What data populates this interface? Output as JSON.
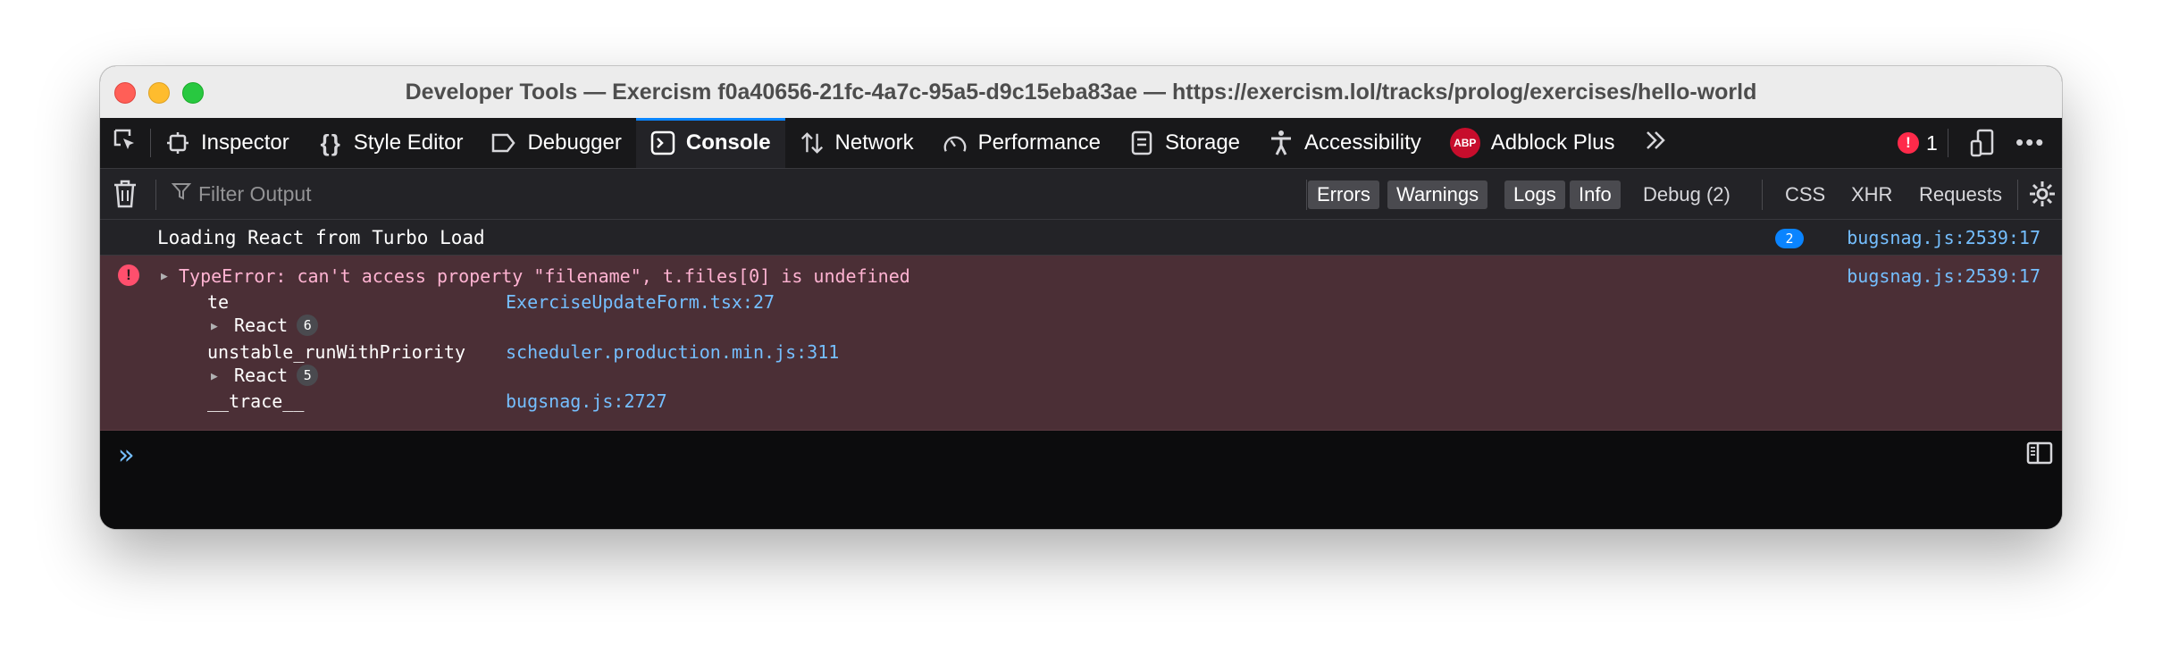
{
  "window": {
    "title": "Developer Tools — Exercism f0a40656-21fc-4a7c-95a5-d9c15eba83ae — https://exercism.lol/tracks/prolog/exercises/hello-world"
  },
  "toolbar": {
    "tabs": [
      {
        "label": "Inspector",
        "icon": "inspector-icon"
      },
      {
        "label": "Style Editor",
        "icon": "braces-icon"
      },
      {
        "label": "Debugger",
        "icon": "debugger-icon"
      },
      {
        "label": "Console",
        "icon": "console-icon",
        "active": true
      },
      {
        "label": "Network",
        "icon": "network-arrows-icon"
      },
      {
        "label": "Performance",
        "icon": "gauge-icon"
      },
      {
        "label": "Storage",
        "icon": "storage-icon"
      },
      {
        "label": "Accessibility",
        "icon": "accessibility-icon"
      },
      {
        "label": "Adblock Plus",
        "icon": "abp-icon"
      }
    ],
    "abp_icon_text": "ABP",
    "error_count": "1"
  },
  "filterbar": {
    "placeholder": "Filter Output",
    "levels": [
      "Errors",
      "Warnings",
      "Logs",
      "Info",
      "Debug (2)"
    ],
    "types": [
      "CSS",
      "XHR",
      "Requests"
    ]
  },
  "console": {
    "log": {
      "text": "Loading React from Turbo Load",
      "count": "2",
      "location": "bugsnag.js:2539:17"
    },
    "error": {
      "message": "TypeError: can't access property \"filename\", t.files[0] is undefined",
      "location": "bugsnag.js:2539:17",
      "stack": [
        {
          "fn": "te",
          "src": "ExerciseUpdateForm.tsx:27"
        },
        {
          "group": "React",
          "count": "6"
        },
        {
          "fn": "unstable_runWithPriority",
          "src": "scheduler.production.min.js:311"
        },
        {
          "group": "React",
          "count": "5"
        },
        {
          "fn": "__trace__",
          "src": "bugsnag.js:2727"
        }
      ]
    },
    "prompt": "»"
  },
  "colors": {
    "accent": "#0a84ff",
    "error_bg": "#4b2f36",
    "error_text": "#ffb3d2",
    "link": "#75bfff"
  }
}
